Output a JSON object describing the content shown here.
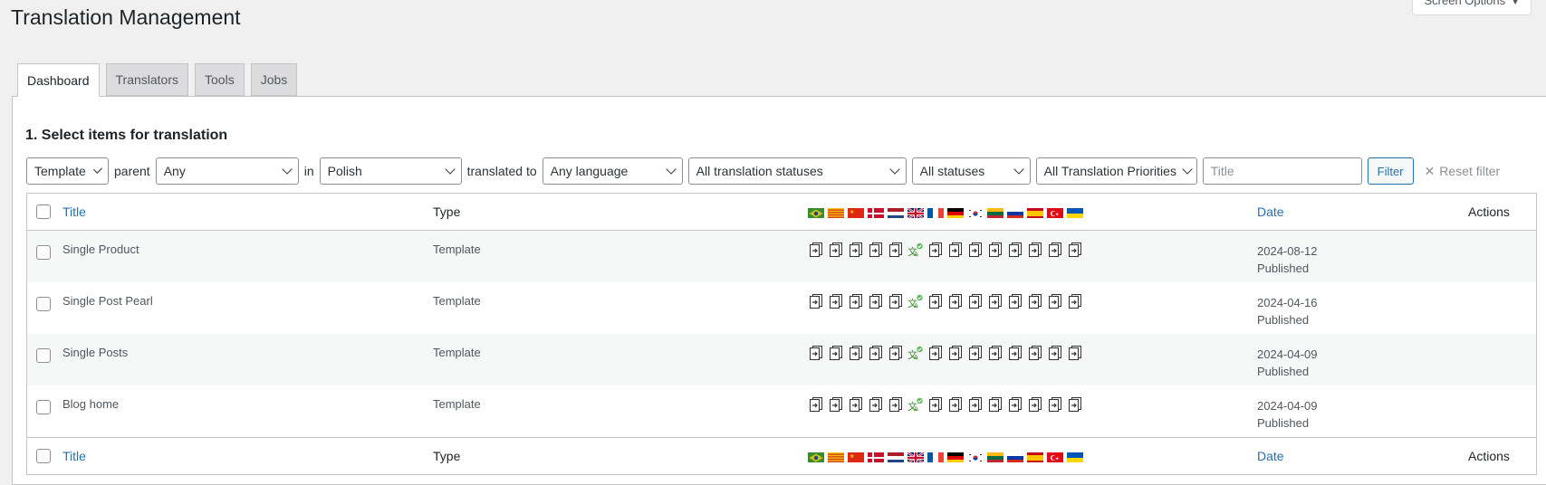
{
  "page": {
    "title": "Translation Management",
    "screen_options": "Screen Options"
  },
  "tabs": [
    {
      "label": "Dashboard",
      "active": true
    },
    {
      "label": "Translators",
      "active": false
    },
    {
      "label": "Tools",
      "active": false
    },
    {
      "label": "Jobs",
      "active": false
    }
  ],
  "section": {
    "title": "1. Select items for translation"
  },
  "filters": {
    "type_value": "Template",
    "parent_label": "parent",
    "parent_value": "Any",
    "in_label": "in",
    "language_value": "Polish",
    "translated_to_label": "translated to",
    "target_value": "Any language",
    "translation_status_value": "All translation statuses",
    "status_value": "All statuses",
    "priority_value": "All Translation Priorities",
    "title_placeholder": "Title",
    "filter_button": "Filter",
    "reset_label": "Reset filter"
  },
  "table": {
    "columns": {
      "title": "Title",
      "type": "Type",
      "date": "Date",
      "actions": "Actions"
    },
    "languages": [
      {
        "code": "pt-br",
        "icon": "flag-brazil"
      },
      {
        "code": "ca",
        "icon": "flag-catalonia"
      },
      {
        "code": "zh",
        "icon": "flag-china"
      },
      {
        "code": "da",
        "icon": "flag-denmark"
      },
      {
        "code": "nl",
        "icon": "flag-netherlands"
      },
      {
        "code": "en",
        "icon": "flag-uk"
      },
      {
        "code": "fr",
        "icon": "flag-france"
      },
      {
        "code": "de",
        "icon": "flag-germany"
      },
      {
        "code": "ko",
        "icon": "flag-korea"
      },
      {
        "code": "lt",
        "icon": "flag-lithuania"
      },
      {
        "code": "ru",
        "icon": "flag-russia"
      },
      {
        "code": "es",
        "icon": "flag-spain"
      },
      {
        "code": "tr",
        "icon": "flag-turkey"
      },
      {
        "code": "uk",
        "icon": "flag-ukraine"
      }
    ],
    "rows": [
      {
        "title": "Single Product",
        "type": "Template",
        "date": "2024-08-12",
        "status": "Published",
        "langs": [
          "add",
          "add",
          "add",
          "add",
          "add",
          "done",
          "add",
          "add",
          "add",
          "add",
          "add",
          "add",
          "add",
          "add"
        ]
      },
      {
        "title": "Single Post Pearl",
        "type": "Template",
        "date": "2024-04-16",
        "status": "Published",
        "langs": [
          "add",
          "add",
          "add",
          "add",
          "add",
          "done",
          "add",
          "add",
          "add",
          "add",
          "add",
          "add",
          "add",
          "add"
        ]
      },
      {
        "title": "Single Posts",
        "type": "Template",
        "date": "2024-04-09",
        "status": "Published",
        "langs": [
          "add",
          "add",
          "add",
          "add",
          "add",
          "done",
          "add",
          "add",
          "add",
          "add",
          "add",
          "add",
          "add",
          "add"
        ]
      },
      {
        "title": "Blog home",
        "type": "Template",
        "date": "2024-04-09",
        "status": "Published",
        "langs": [
          "add",
          "add",
          "add",
          "add",
          "add",
          "done",
          "add",
          "add",
          "add",
          "add",
          "add",
          "add",
          "add",
          "add"
        ]
      }
    ]
  }
}
